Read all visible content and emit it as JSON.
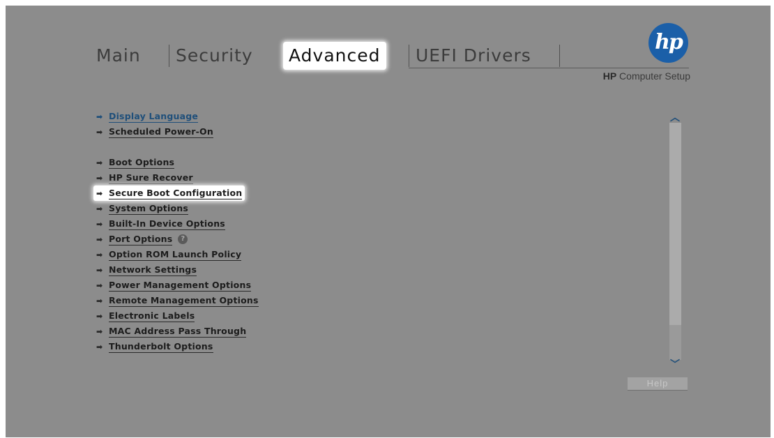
{
  "tabs": [
    {
      "label": "Main"
    },
    {
      "label": "Security"
    },
    {
      "label": "Advanced"
    },
    {
      "label": "UEFI Drivers"
    }
  ],
  "active_tab": "Advanced",
  "brand": {
    "logo_text": "hp",
    "title_bold": "HP",
    "title_rest": " Computer Setup",
    "logo_color": "#1b5fa8"
  },
  "menu": [
    {
      "label": "Display Language"
    },
    {
      "label": "Scheduled Power-On"
    },
    {
      "label": "Boot Options"
    },
    {
      "label": "HP Sure Recover"
    },
    {
      "label": "Secure Boot Configuration"
    },
    {
      "label": "System Options"
    },
    {
      "label": "Built-In Device Options"
    },
    {
      "label": "Port Options"
    },
    {
      "label": "Option ROM Launch Policy"
    },
    {
      "label": "Network Settings"
    },
    {
      "label": "Power Management Options"
    },
    {
      "label": "Remote Management Options"
    },
    {
      "label": "Electronic Labels"
    },
    {
      "label": "MAC Address Pass Through"
    },
    {
      "label": "Thunderbolt Options"
    }
  ],
  "selected_item": "Secure Boot Configuration",
  "icons": {
    "item_arrow": "right-arrow-icon",
    "port_help": "question-icon",
    "scroll_up": "chevron-up-icon",
    "scroll_down": "chevron-down-icon"
  },
  "help_button": "Help"
}
